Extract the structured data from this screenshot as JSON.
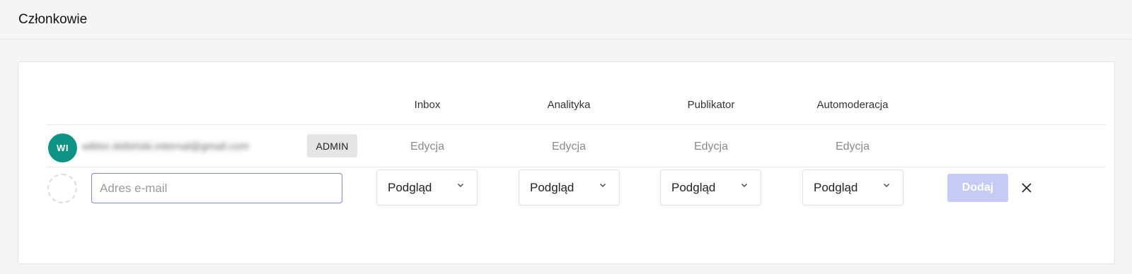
{
  "header": {
    "title": "Członkowie"
  },
  "columns": [
    "Inbox",
    "Analityka",
    "Publikator",
    "Automoderacja"
  ],
  "member": {
    "initials": "WI",
    "email": "wiktor.skibiński.internal@gmail.com",
    "role": "ADMIN",
    "permissions": [
      "Edycja",
      "Edycja",
      "Edycja",
      "Edycja"
    ],
    "avatar_color": "#0f9384"
  },
  "new_member": {
    "email_placeholder": "Adres e-mail",
    "email_value": "",
    "permissions": [
      "Podgląd",
      "Podgląd",
      "Podgląd",
      "Podgląd"
    ],
    "add_label": "Dodaj",
    "add_button_color": "#c6cbf3"
  },
  "icons": {
    "dropdown": "chevron-down-icon",
    "remove": "close-icon"
  }
}
